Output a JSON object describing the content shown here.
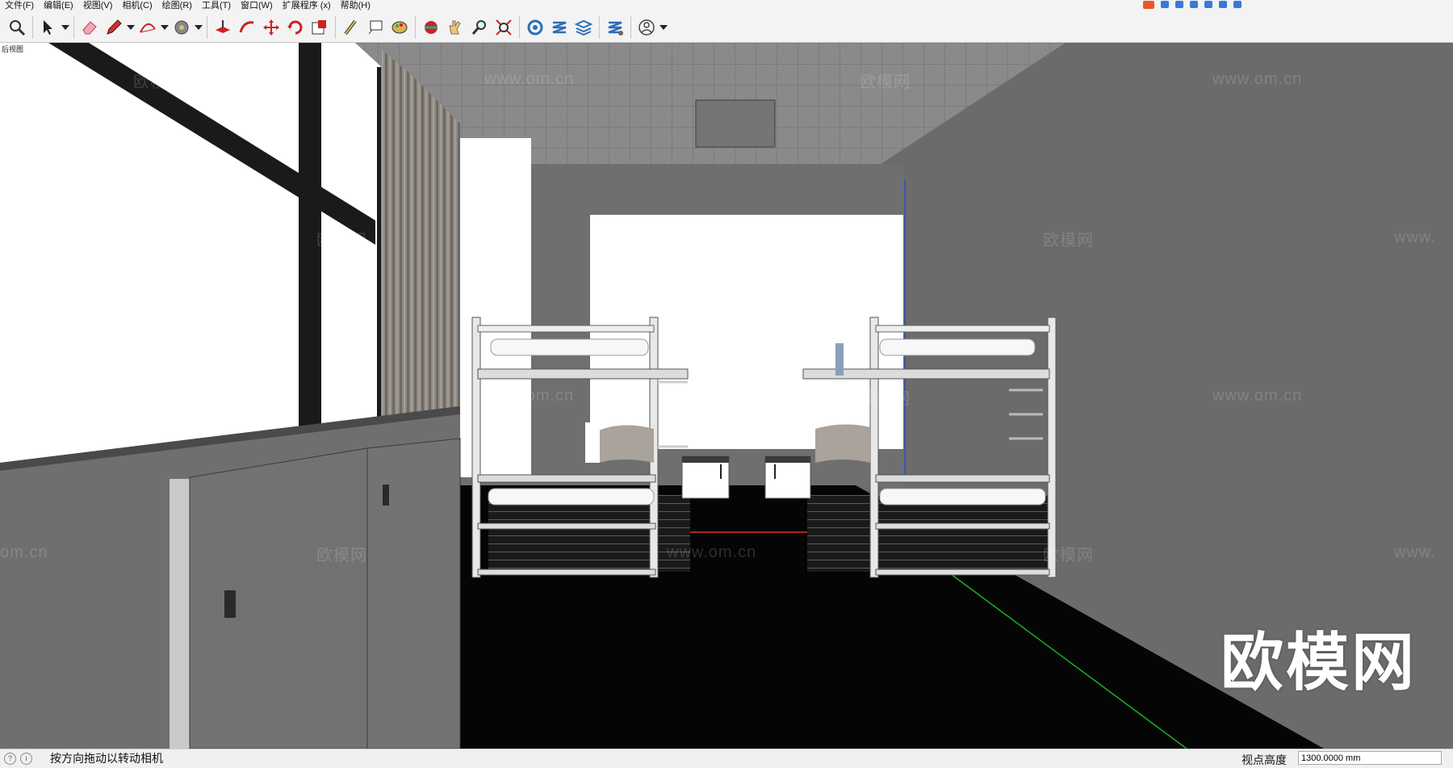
{
  "menu": [
    "文件(F)",
    "编辑(E)",
    "视图(V)",
    "相机(C)",
    "绘图(R)",
    "工具(T)",
    "窗口(W)",
    "扩展程序 (x)",
    "帮助(H)"
  ],
  "scene_tab": "后视图",
  "toolbar": {
    "tools": [
      "zoom-icon",
      "select-icon",
      "eraser-icon",
      "pencil-icon",
      "arc-icon",
      "paint-bucket-icon",
      "push-pull-icon",
      "follow-me-icon",
      "move-icon",
      "rotate-icon",
      "scale-icon",
      "tape-measure-icon",
      "text-icon",
      "paint-icon",
      "orbit-icon",
      "pan-icon",
      "zoom-window-icon",
      "zoom-extents-icon",
      "warehouse-icon",
      "extension-icon",
      "layers-icon",
      "extension-manager-icon",
      "account-icon"
    ]
  },
  "watermarks": {
    "site": "www.om.cn",
    "site_partial": "om.cn",
    "site_partial_right": "www.",
    "brand": "欧模网"
  },
  "status": {
    "hint": "按方向拖动以转动相机",
    "vcb_label": "视点高度",
    "vcb_value": "1300.0000 mm"
  },
  "colors": {
    "wall": "#6b6b6b",
    "floor": "#050505",
    "ceiling": "#8a8a8a",
    "accent_red": "#e03232",
    "axis_green": "#20b020",
    "axis_blue": "#3050c0"
  }
}
